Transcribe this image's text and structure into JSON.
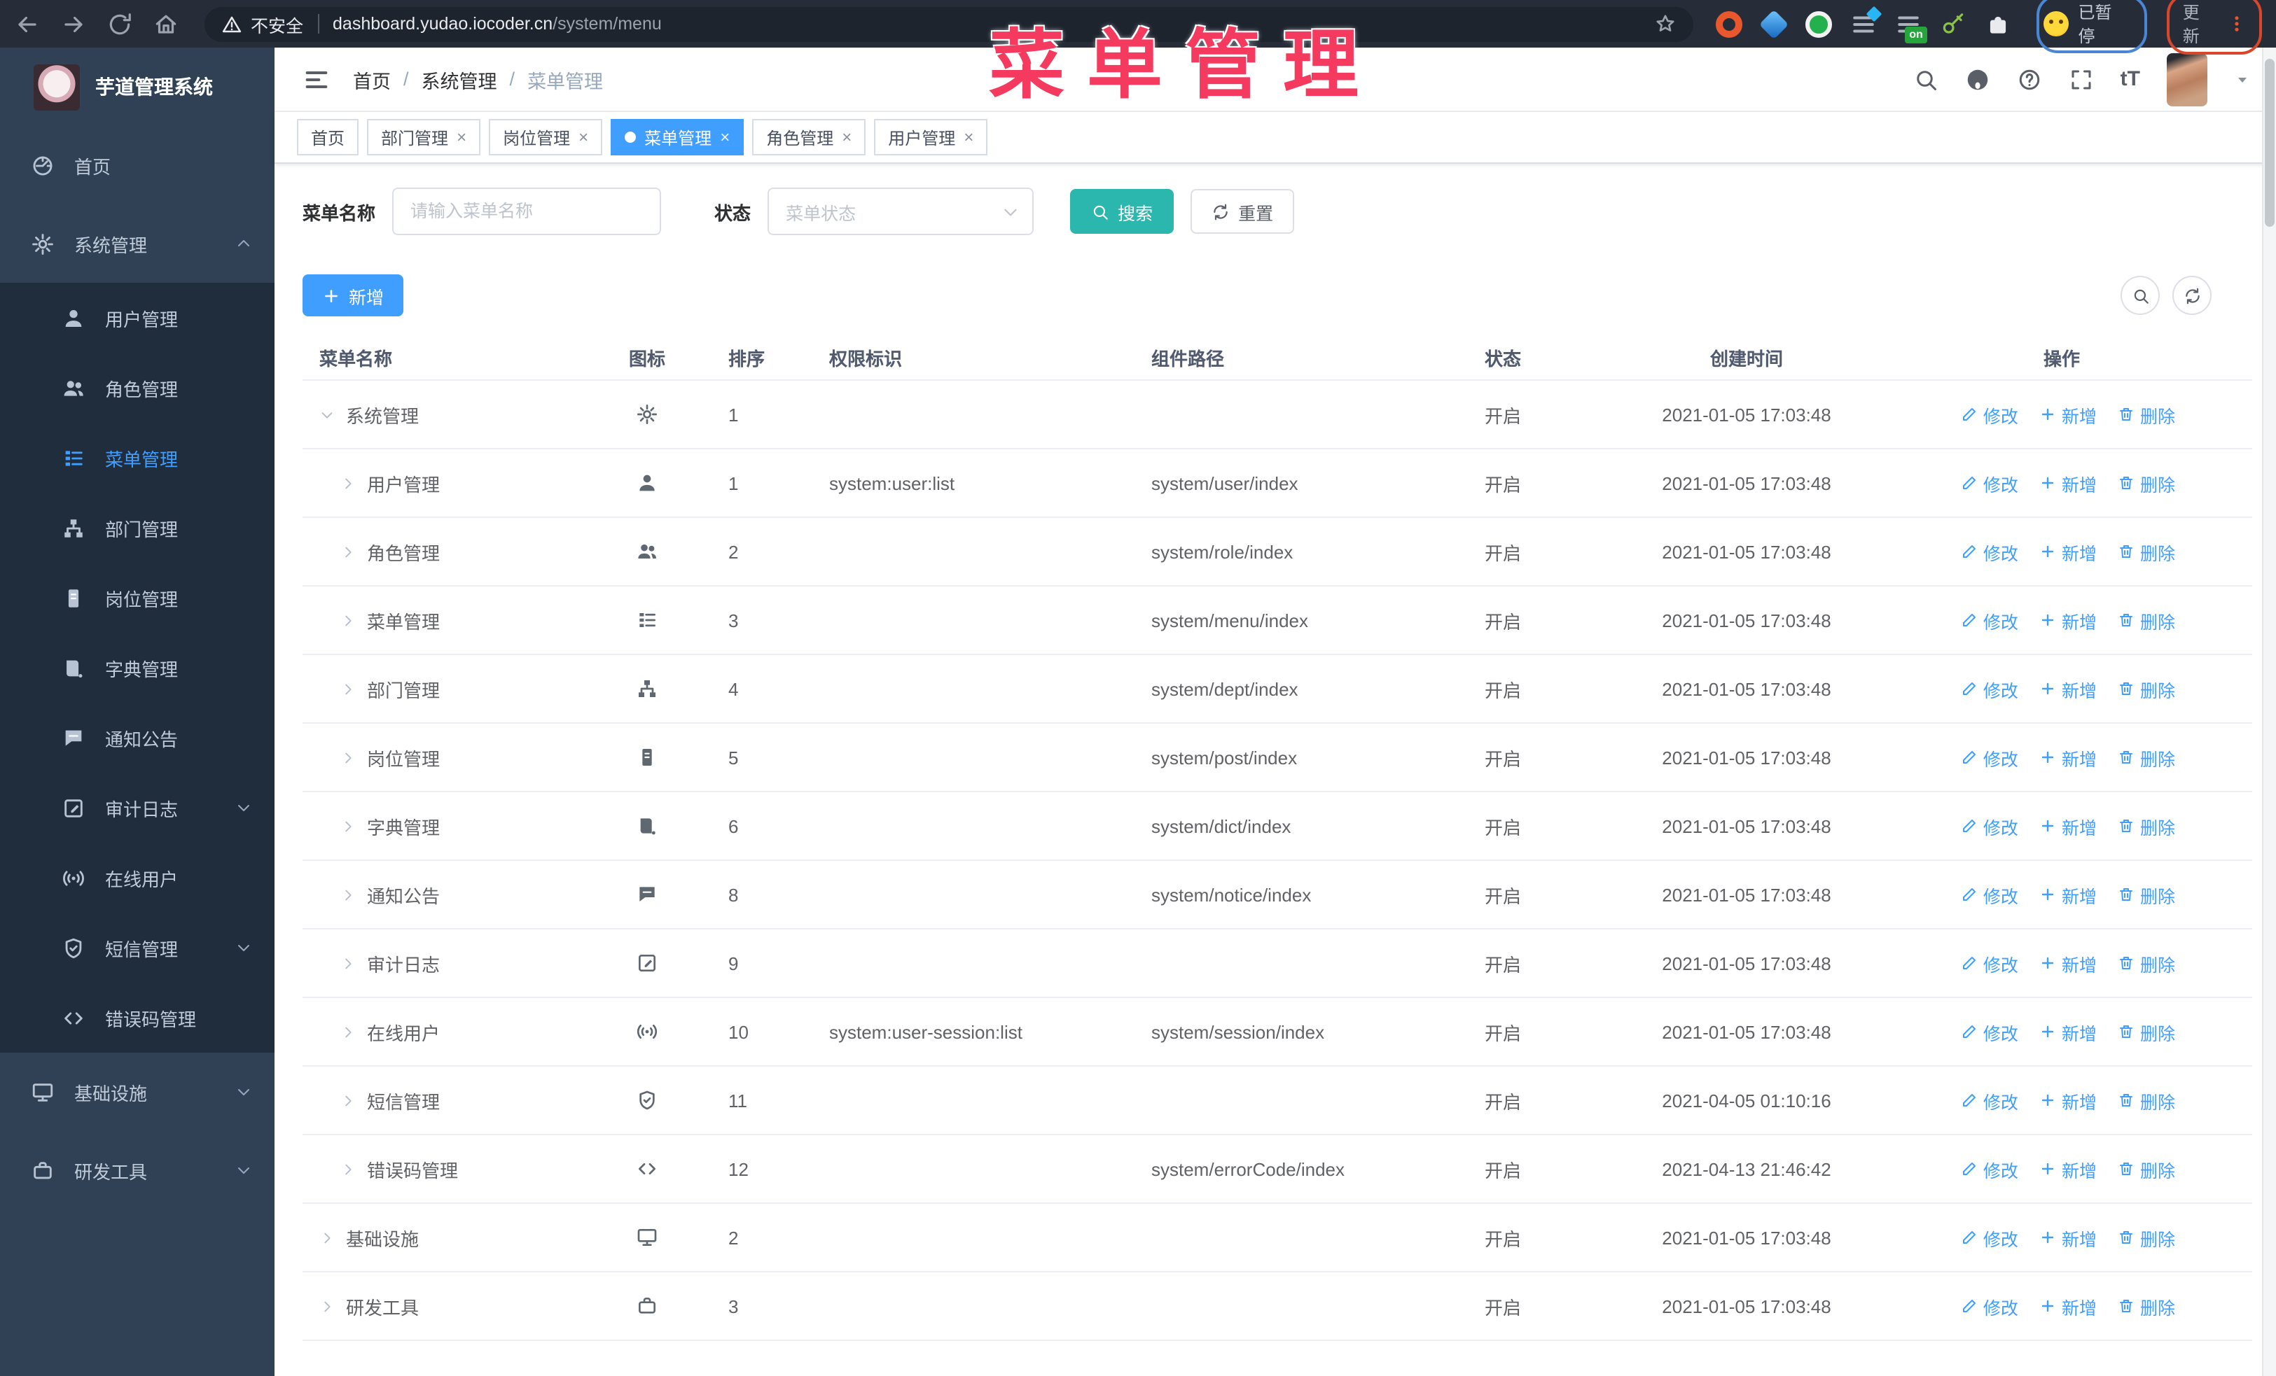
{
  "browser": {
    "security_label": "不安全",
    "url_host": "dashboard.yudao.iocoder.cn",
    "url_path": "/system/menu",
    "paused_badge": "已暂停",
    "update_button": "更新",
    "ext_on_badge": "on"
  },
  "watermark": "菜单管理",
  "sidebar": {
    "app_title": "芋道管理系统",
    "items": [
      {
        "key": "home",
        "label": "首页",
        "icon": "dashboard-icon"
      },
      {
        "key": "system",
        "label": "系统管理",
        "icon": "gear-icon",
        "expanded": true,
        "arrow": "up",
        "children": [
          {
            "key": "user",
            "label": "用户管理",
            "icon": "user-icon"
          },
          {
            "key": "role",
            "label": "角色管理",
            "icon": "users-icon"
          },
          {
            "key": "menu",
            "label": "菜单管理",
            "icon": "menu-icon",
            "active": true
          },
          {
            "key": "dept",
            "label": "部门管理",
            "icon": "tree-icon"
          },
          {
            "key": "post",
            "label": "岗位管理",
            "icon": "post-icon"
          },
          {
            "key": "dict",
            "label": "字典管理",
            "icon": "book-icon"
          },
          {
            "key": "notice",
            "label": "通知公告",
            "icon": "message-icon"
          },
          {
            "key": "audit-log",
            "label": "审计日志",
            "icon": "log-icon",
            "arrow": "down"
          },
          {
            "key": "online-user",
            "label": "在线用户",
            "icon": "online-icon"
          },
          {
            "key": "sms",
            "label": "短信管理",
            "icon": "shield-icon",
            "arrow": "down"
          },
          {
            "key": "error-code",
            "label": "错误码管理",
            "icon": "code-icon"
          }
        ]
      },
      {
        "key": "infra",
        "label": "基础设施",
        "icon": "monitor-icon",
        "arrow": "down"
      },
      {
        "key": "dev-tool",
        "label": "研发工具",
        "icon": "tool-icon",
        "arrow": "down"
      }
    ]
  },
  "header": {
    "breadcrumb": [
      "首页",
      "系统管理",
      "菜单管理"
    ],
    "font_size_icon_label": "tT"
  },
  "tabs": [
    {
      "label": "首页",
      "closable": false,
      "active": false
    },
    {
      "label": "部门管理",
      "closable": true,
      "active": false
    },
    {
      "label": "岗位管理",
      "closable": true,
      "active": false
    },
    {
      "label": "菜单管理",
      "closable": true,
      "active": true
    },
    {
      "label": "角色管理",
      "closable": true,
      "active": false
    },
    {
      "label": "用户管理",
      "closable": true,
      "active": false
    }
  ],
  "filters": {
    "name_label": "菜单名称",
    "name_placeholder": "请输入菜单名称",
    "status_label": "状态",
    "status_placeholder": "菜单状态",
    "search_button": "搜索",
    "reset_button": "重置"
  },
  "toolbar": {
    "add_button": "新增"
  },
  "table": {
    "columns": [
      "菜单名称",
      "图标",
      "排序",
      "权限标识",
      "组件路径",
      "状态",
      "创建时间",
      "操作"
    ],
    "actions": {
      "edit": "修改",
      "add": "新增",
      "delete": "删除"
    },
    "rows": [
      {
        "name": "系统管理",
        "level": 0,
        "expanded": true,
        "icon": "gear-icon",
        "sort": "1",
        "perm": "",
        "path": "",
        "status": "开启",
        "time": "2021-01-05 17:03:48"
      },
      {
        "name": "用户管理",
        "level": 1,
        "expanded": false,
        "icon": "user-icon",
        "sort": "1",
        "perm": "system:user:list",
        "path": "system/user/index",
        "status": "开启",
        "time": "2021-01-05 17:03:48"
      },
      {
        "name": "角色管理",
        "level": 1,
        "expanded": false,
        "icon": "users-icon",
        "sort": "2",
        "perm": "",
        "path": "system/role/index",
        "status": "开启",
        "time": "2021-01-05 17:03:48"
      },
      {
        "name": "菜单管理",
        "level": 1,
        "expanded": false,
        "icon": "menu-icon",
        "sort": "3",
        "perm": "",
        "path": "system/menu/index",
        "status": "开启",
        "time": "2021-01-05 17:03:48"
      },
      {
        "name": "部门管理",
        "level": 1,
        "expanded": false,
        "icon": "tree-icon",
        "sort": "4",
        "perm": "",
        "path": "system/dept/index",
        "status": "开启",
        "time": "2021-01-05 17:03:48"
      },
      {
        "name": "岗位管理",
        "level": 1,
        "expanded": false,
        "icon": "post-icon",
        "sort": "5",
        "perm": "",
        "path": "system/post/index",
        "status": "开启",
        "time": "2021-01-05 17:03:48"
      },
      {
        "name": "字典管理",
        "level": 1,
        "expanded": false,
        "icon": "book-icon",
        "sort": "6",
        "perm": "",
        "path": "system/dict/index",
        "status": "开启",
        "time": "2021-01-05 17:03:48"
      },
      {
        "name": "通知公告",
        "level": 1,
        "expanded": false,
        "icon": "message-icon",
        "sort": "8",
        "perm": "",
        "path": "system/notice/index",
        "status": "开启",
        "time": "2021-01-05 17:03:48"
      },
      {
        "name": "审计日志",
        "level": 1,
        "expanded": false,
        "icon": "log-icon",
        "sort": "9",
        "perm": "",
        "path": "",
        "status": "开启",
        "time": "2021-01-05 17:03:48"
      },
      {
        "name": "在线用户",
        "level": 1,
        "expanded": false,
        "icon": "online-icon",
        "sort": "10",
        "perm": "system:user-session:list",
        "path": "system/session/index",
        "status": "开启",
        "time": "2021-01-05 17:03:48"
      },
      {
        "name": "短信管理",
        "level": 1,
        "expanded": false,
        "icon": "shield-icon",
        "sort": "11",
        "perm": "",
        "path": "",
        "status": "开启",
        "time": "2021-04-05 01:10:16"
      },
      {
        "name": "错误码管理",
        "level": 1,
        "expanded": false,
        "icon": "code-icon",
        "sort": "12",
        "perm": "",
        "path": "system/errorCode/index",
        "status": "开启",
        "time": "2021-04-13 21:46:42"
      },
      {
        "name": "基础设施",
        "level": 0,
        "expanded": false,
        "icon": "monitor-icon",
        "sort": "2",
        "perm": "",
        "path": "",
        "status": "开启",
        "time": "2021-01-05 17:03:48"
      },
      {
        "name": "研发工具",
        "level": 0,
        "expanded": false,
        "icon": "tool-icon",
        "sort": "3",
        "perm": "",
        "path": "",
        "status": "开启",
        "time": "2021-01-05 17:03:48"
      }
    ]
  },
  "colors": {
    "primary": "#409EFF",
    "search_teal": "#2bb6ae",
    "watermark_pink": "#f43b5f",
    "sidebar_bg": "#304156",
    "submenu_bg": "#1f2d3d",
    "active_tag_bg": "#409EFF"
  }
}
